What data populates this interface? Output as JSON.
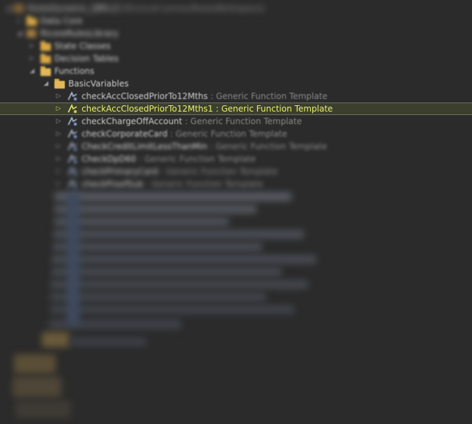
{
  "tree": {
    "root": {
      "label": "RulesDynamic_[BRL2]",
      "detail": "[Ricocod-Lemon/RulesWorkspace]"
    },
    "items": [
      {
        "label": "Data Core"
      },
      {
        "label": "RicoreRulesLibrary"
      },
      {
        "label": "State Classes"
      },
      {
        "label": "Decision Tables"
      },
      {
        "label": "Functions"
      },
      {
        "label": "BasicVariables"
      }
    ],
    "functions": [
      {
        "name": "checkAccClosedPriorTo12Mths",
        "type": " : Generic Function Template"
      },
      {
        "name": "checkAccClosedPriorTo12Mths1 : Generic Function Template",
        "type": ""
      },
      {
        "name": "checkChargeOffAccount",
        "type": " : Generic Function Template"
      },
      {
        "name": "checkCorporateCard",
        "type": " : Generic Function Template"
      },
      {
        "name": "CheckCreditLimitLessThanMin",
        "type": " : Generic Function Template"
      },
      {
        "name": "CheckDpD60",
        "type": " : Generic Function Template"
      },
      {
        "name": "checkPrimaryCard",
        "type": " : Generic Function Template"
      },
      {
        "name": "checkProofSub",
        "type": " : Generic Function Template"
      }
    ],
    "selected_index": 1
  },
  "colors": {
    "background": "#2b2b2b",
    "selected_text": "#e8f06a",
    "folder": "#d9a845"
  }
}
